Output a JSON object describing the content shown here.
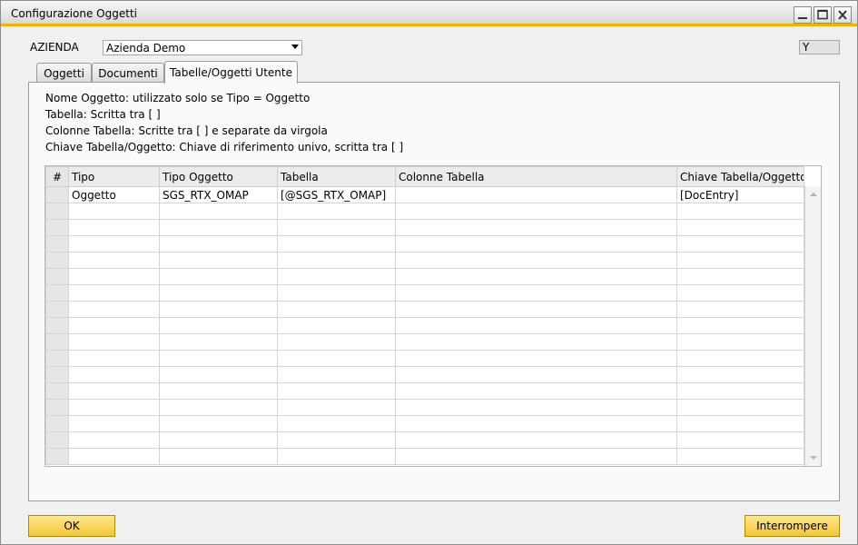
{
  "window": {
    "title": "Configurazione Oggetti"
  },
  "header": {
    "company_label": "AZIENDA",
    "company_value": "Azienda Demo",
    "flag_value": "Y"
  },
  "tabs": [
    {
      "label": "Oggetti",
      "active": false
    },
    {
      "label": "Documenti",
      "active": false
    },
    {
      "label": "Tabelle/Oggetti Utente",
      "active": true
    }
  ],
  "info_lines": [
    "Nome Oggetto: utilizzato solo se Tipo = Oggetto",
    "Tabella: Scritta tra [ ]",
    "Colonne Tabella: Scritte tra [ ] e separate da virgola",
    "Chiave Tabella/Oggetto: Chiave di riferimento univo, scritta tra [ ]"
  ],
  "grid": {
    "columns": [
      "#",
      "Tipo",
      "Tipo Oggetto",
      "Tabella",
      "Colonne Tabella",
      "Chiave Tabella/Oggetto"
    ],
    "rows": [
      [
        "",
        "Oggetto",
        "SGS_RTX_OMAP",
        "[@SGS_RTX_OMAP]",
        "",
        "[DocEntry]"
      ]
    ]
  },
  "buttons": {
    "ok": "OK",
    "cancel": "Interrompere"
  },
  "colors": {
    "accent": "#f0b400",
    "button": "#f5cd4c"
  },
  "icons": [
    "minimize-icon",
    "maximize-icon",
    "close-icon",
    "dropdown-arrow-icon",
    "scroll-up-icon",
    "scroll-down-icon"
  ]
}
